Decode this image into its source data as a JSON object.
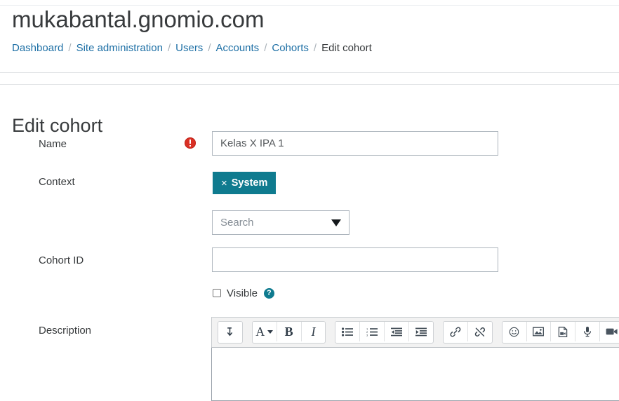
{
  "header": {
    "site_title": "mukabantal.gnomio.com"
  },
  "breadcrumb": {
    "items": [
      {
        "label": "Dashboard",
        "current": false
      },
      {
        "label": "Site administration",
        "current": false
      },
      {
        "label": "Users",
        "current": false
      },
      {
        "label": "Accounts",
        "current": false
      },
      {
        "label": "Cohorts",
        "current": false
      },
      {
        "label": "Edit cohort",
        "current": true
      }
    ],
    "separator": "/"
  },
  "page": {
    "heading": "Edit cohort"
  },
  "form": {
    "name": {
      "label": "Name",
      "value": "Kelas X IPA 1",
      "required_icon": "required-error-icon"
    },
    "context": {
      "label": "Context",
      "tag_remove": "×",
      "tag_label": "System",
      "search_placeholder": "Search",
      "dropdown_icon": "caret-down-icon"
    },
    "cohort_id": {
      "label": "Cohort ID",
      "value": "",
      "placeholder": ""
    },
    "visible": {
      "label": "Visible",
      "checked": false,
      "help_icon": "help-circle-icon",
      "help_glyph": "?"
    },
    "description": {
      "label": "Description",
      "content": ""
    }
  },
  "editor": {
    "groups": [
      {
        "buttons": [
          {
            "name": "expand-toolbar-icon",
            "glyph": ""
          }
        ]
      },
      {
        "buttons": [
          {
            "name": "font-style-dropdown-icon",
            "glyph": "A"
          },
          {
            "name": "bold-icon",
            "glyph": "B"
          },
          {
            "name": "italic-icon",
            "glyph": "I"
          }
        ]
      },
      {
        "buttons": [
          {
            "name": "bullet-list-icon",
            "glyph": ""
          },
          {
            "name": "numbered-list-icon",
            "glyph": ""
          },
          {
            "name": "outdent-icon",
            "glyph": ""
          },
          {
            "name": "indent-icon",
            "glyph": ""
          }
        ]
      },
      {
        "buttons": [
          {
            "name": "link-icon",
            "glyph": ""
          },
          {
            "name": "unlink-icon",
            "glyph": ""
          }
        ]
      },
      {
        "buttons": [
          {
            "name": "emoji-icon",
            "glyph": ""
          },
          {
            "name": "insert-image-icon",
            "glyph": ""
          },
          {
            "name": "insert-media-file-icon",
            "glyph": ""
          },
          {
            "name": "record-audio-icon",
            "glyph": ""
          },
          {
            "name": "record-video-icon",
            "glyph": ""
          }
        ]
      }
    ]
  },
  "colors": {
    "link": "#1d6fa5",
    "teal": "#0f7b8f",
    "required_red": "#d93025",
    "text": "#373a3c",
    "border": "#adb5bd"
  }
}
